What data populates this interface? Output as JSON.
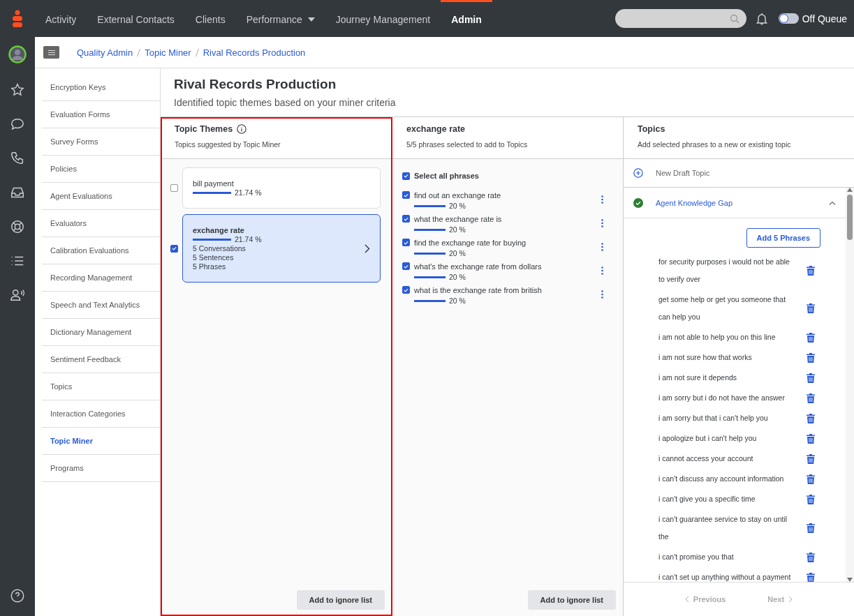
{
  "top_nav": {
    "items": [
      {
        "label": "Activity",
        "selected": false,
        "dropdown": false
      },
      {
        "label": "External Contacts",
        "selected": false,
        "dropdown": false
      },
      {
        "label": "Clients",
        "selected": false,
        "dropdown": false
      },
      {
        "label": "Performance",
        "selected": false,
        "dropdown": true
      },
      {
        "label": "Journey Management",
        "selected": false,
        "dropdown": false
      },
      {
        "label": "Admin",
        "selected": true,
        "dropdown": false
      }
    ],
    "queue_toggle": {
      "label": "Off Queue",
      "on": false
    }
  },
  "breadcrumbs": [
    "Quality Admin",
    "Topic Miner",
    "Rival Records Production"
  ],
  "sidebar": {
    "items": [
      {
        "label": "Encryption Keys",
        "selected": false
      },
      {
        "label": "Evaluation Forms",
        "selected": false
      },
      {
        "label": "Survey Forms",
        "selected": false
      },
      {
        "label": "Policies",
        "selected": false
      },
      {
        "label": "Agent Evaluations",
        "selected": false
      },
      {
        "label": "Evaluators",
        "selected": false
      },
      {
        "label": "Calibration Evaluations",
        "selected": false
      },
      {
        "label": "Recording Management",
        "selected": false
      },
      {
        "label": "Speech and Text Analytics",
        "selected": false
      },
      {
        "label": "Dictionary Management",
        "selected": false
      },
      {
        "label": "Sentiment Feedback",
        "selected": false
      },
      {
        "label": "Topics",
        "selected": false
      },
      {
        "label": "Interaction Categories",
        "selected": false
      },
      {
        "label": "Topic Miner",
        "selected": true
      },
      {
        "label": "Programs",
        "selected": false
      }
    ]
  },
  "page": {
    "title": "Rival Records Production",
    "subtitle": "Identified topic themes based on your miner criteria"
  },
  "topic_themes": {
    "title": "Topic Themes",
    "subtitle": "Topics suggested by Topic Miner",
    "highlighted": true,
    "themes": [
      {
        "name": "bill payment",
        "level": 1,
        "percent": "21.74 %",
        "checked": false,
        "selected": false
      },
      {
        "name": "exchange rate",
        "level": 1,
        "percent": "21.74 %",
        "checked": true,
        "selected": true,
        "details": [
          "5 Conversations",
          "5 Sentences",
          "5 Phrases"
        ]
      }
    ],
    "button": "Add to ignore list"
  },
  "phrases": {
    "title": "exchange rate",
    "subtitle": "5/5 phrases selected to add to Topics",
    "select_all": {
      "label": "Select all phrases",
      "checked": true
    },
    "items": [
      {
        "text": "find out an exchange rate",
        "level": 1,
        "percent": "20 %",
        "checked": true
      },
      {
        "text": "what the exchange rate is",
        "level": 1,
        "percent": "20 %",
        "checked": true
      },
      {
        "text": "find the exchange rate for buying",
        "level": 1,
        "percent": "20 %",
        "checked": true
      },
      {
        "text": "what's the exchange rate from dollars",
        "level": 1,
        "percent": "20 %",
        "checked": true
      },
      {
        "text": "what is the exchange rate from british",
        "level": 1,
        "percent": "20 %",
        "checked": true
      }
    ],
    "button": "Add to ignore list"
  },
  "topics": {
    "title": "Topics",
    "subtitle": "Add selected phrases to a new or existing topic",
    "new_topic": "New Draft Topic",
    "topic": {
      "name": "Agent Knowledge Gap",
      "expanded": true,
      "button": "Add 5 Phrases",
      "phrases": [
        "for security purposes i would not be able to verify over",
        "get some help or get you someone that can help you",
        "i am not able to help you on this line",
        "i am not sure how that works",
        "i am not sure it depends",
        "i am sorry but i do not have the answer",
        "i am sorry but that i can't help you",
        "i apologize but i can't help you",
        "i cannot access your account",
        "i can't discuss any account information",
        "i can't give you a specific time",
        "i can't guarantee service to stay on until the",
        "i can't promise you that",
        "i can't set up anything without a payment"
      ]
    },
    "pager": {
      "previous": "Previous",
      "next": "Next"
    }
  }
}
